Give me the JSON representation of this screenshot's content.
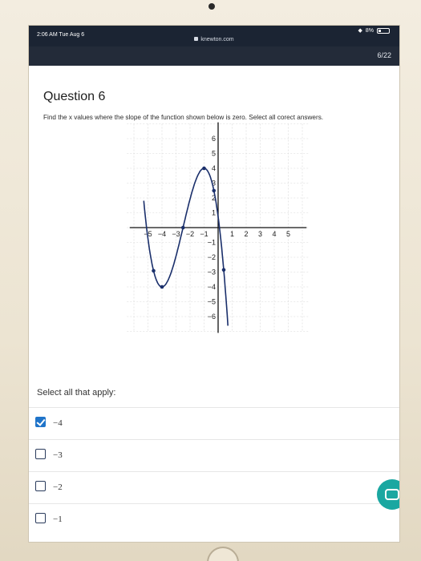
{
  "status_bar": {
    "time": "2:06 AM  Tue Aug 6",
    "battery": "8%"
  },
  "browser": {
    "url": "knewton.com"
  },
  "nav": {
    "progress": "6/22"
  },
  "question": {
    "title": "Question 6",
    "prompt": "Find the x values where the slope of the function shown below is zero. Select all corect answers."
  },
  "graph": {
    "x_ticks": [
      "−5",
      "−4",
      "−3",
      "−2",
      "−1",
      "1",
      "2",
      "3",
      "4",
      "5"
    ],
    "y_ticks": [
      "6",
      "5",
      "4",
      "3",
      "2",
      "1",
      "−1",
      "−2",
      "−3",
      "−4",
      "−5",
      "−6"
    ],
    "curve_color": "#1a2f6b"
  },
  "answers": {
    "select_label": "Select all that apply:",
    "options": [
      {
        "label": "−4",
        "checked": true
      },
      {
        "label": "−3",
        "checked": false
      },
      {
        "label": "−2",
        "checked": false
      },
      {
        "label": "−1",
        "checked": false
      }
    ]
  },
  "accent": {
    "check": "#1f74c9",
    "chat": "#1aa7a1"
  }
}
